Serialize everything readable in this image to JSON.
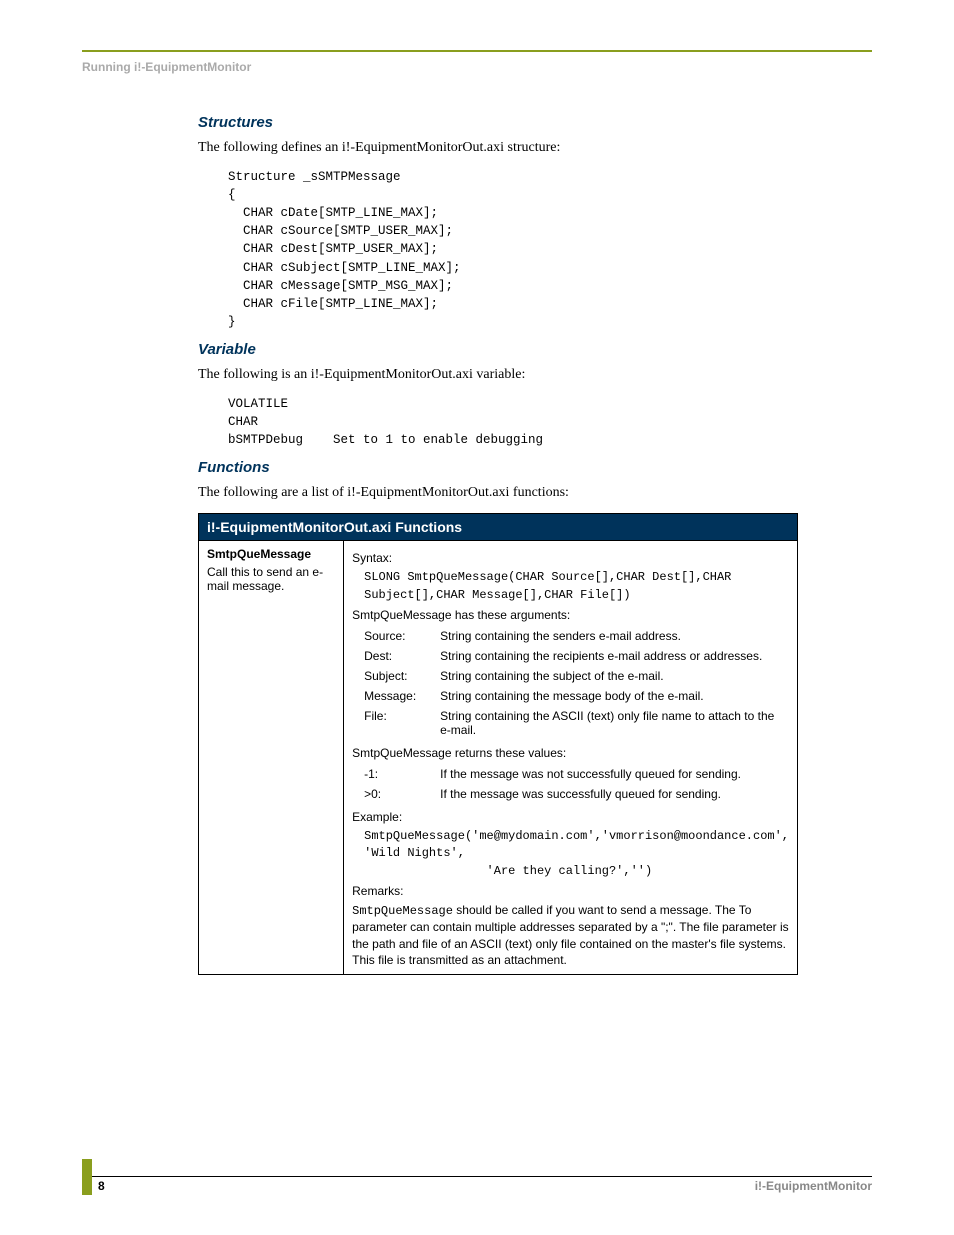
{
  "running_head": "Running i!-EquipmentMonitor",
  "sections": {
    "structures": {
      "heading": "Structures",
      "intro": "The following defines an i!-EquipmentMonitorOut.axi structure:",
      "code": "Structure _sSMTPMessage\n{\n  CHAR cDate[SMTP_LINE_MAX];\n  CHAR cSource[SMTP_USER_MAX];\n  CHAR cDest[SMTP_USER_MAX];\n  CHAR cSubject[SMTP_LINE_MAX];\n  CHAR cMessage[SMTP_MSG_MAX];\n  CHAR cFile[SMTP_LINE_MAX];\n}"
    },
    "variable": {
      "heading": "Variable",
      "intro": "The following is an i!-EquipmentMonitorOut.axi variable:",
      "code": "VOLATILE\nCHAR\nbSMTPDebug    Set to 1 to enable debugging"
    },
    "functions": {
      "heading": "Functions",
      "intro": "The following are a list of i!-EquipmentMonitorOut.axi functions:",
      "table_title": "i!-EquipmentMonitorOut.axi Functions",
      "fn": {
        "name": "SmtpQueMessage",
        "desc": "Call this to send an e-mail message.",
        "syntax_label": "Syntax:",
        "syntax_code": "SLONG SmtpQueMessage(CHAR Source[],CHAR Dest[],CHAR\nSubject[],CHAR Message[],CHAR File[])",
        "args_intro": "SmtpQueMessage has these arguments:",
        "args": [
          {
            "name": "Source:",
            "desc": "String containing the senders e-mail address."
          },
          {
            "name": "Dest:",
            "desc": "String containing the recipients e-mail address or addresses."
          },
          {
            "name": "Subject:",
            "desc": "String containing the subject of the e-mail."
          },
          {
            "name": "Message:",
            "desc": "String containing the message body of the e-mail."
          },
          {
            "name": "File:",
            "desc": "String containing the ASCII (text) only file name to attach to the e-mail."
          }
        ],
        "returns_intro": "SmtpQueMessage returns these values:",
        "returns": [
          {
            "name": "-1:",
            "desc": "If the message was not successfully queued for sending."
          },
          {
            "name": ">0:",
            "desc": "If the message was successfully queued for sending."
          }
        ],
        "example_label": "Example:",
        "example_code": "SmtpQueMessage('me@mydomain.com','vmorrison@moondance.com',\n'Wild Nights',\n                 'Are they calling?','')",
        "remarks_label": "Remarks:",
        "remarks_code": "SmtpQueMessage",
        "remarks_text": " should be called if you want to send a message. The To parameter can contain multiple addresses separated by a \";\". The file parameter is the path and file of an ASCII (text) only file contained on the master's file systems. This file is transmitted as an attachment."
      }
    }
  },
  "footer": {
    "page": "8",
    "title": "i!-EquipmentMonitor"
  }
}
